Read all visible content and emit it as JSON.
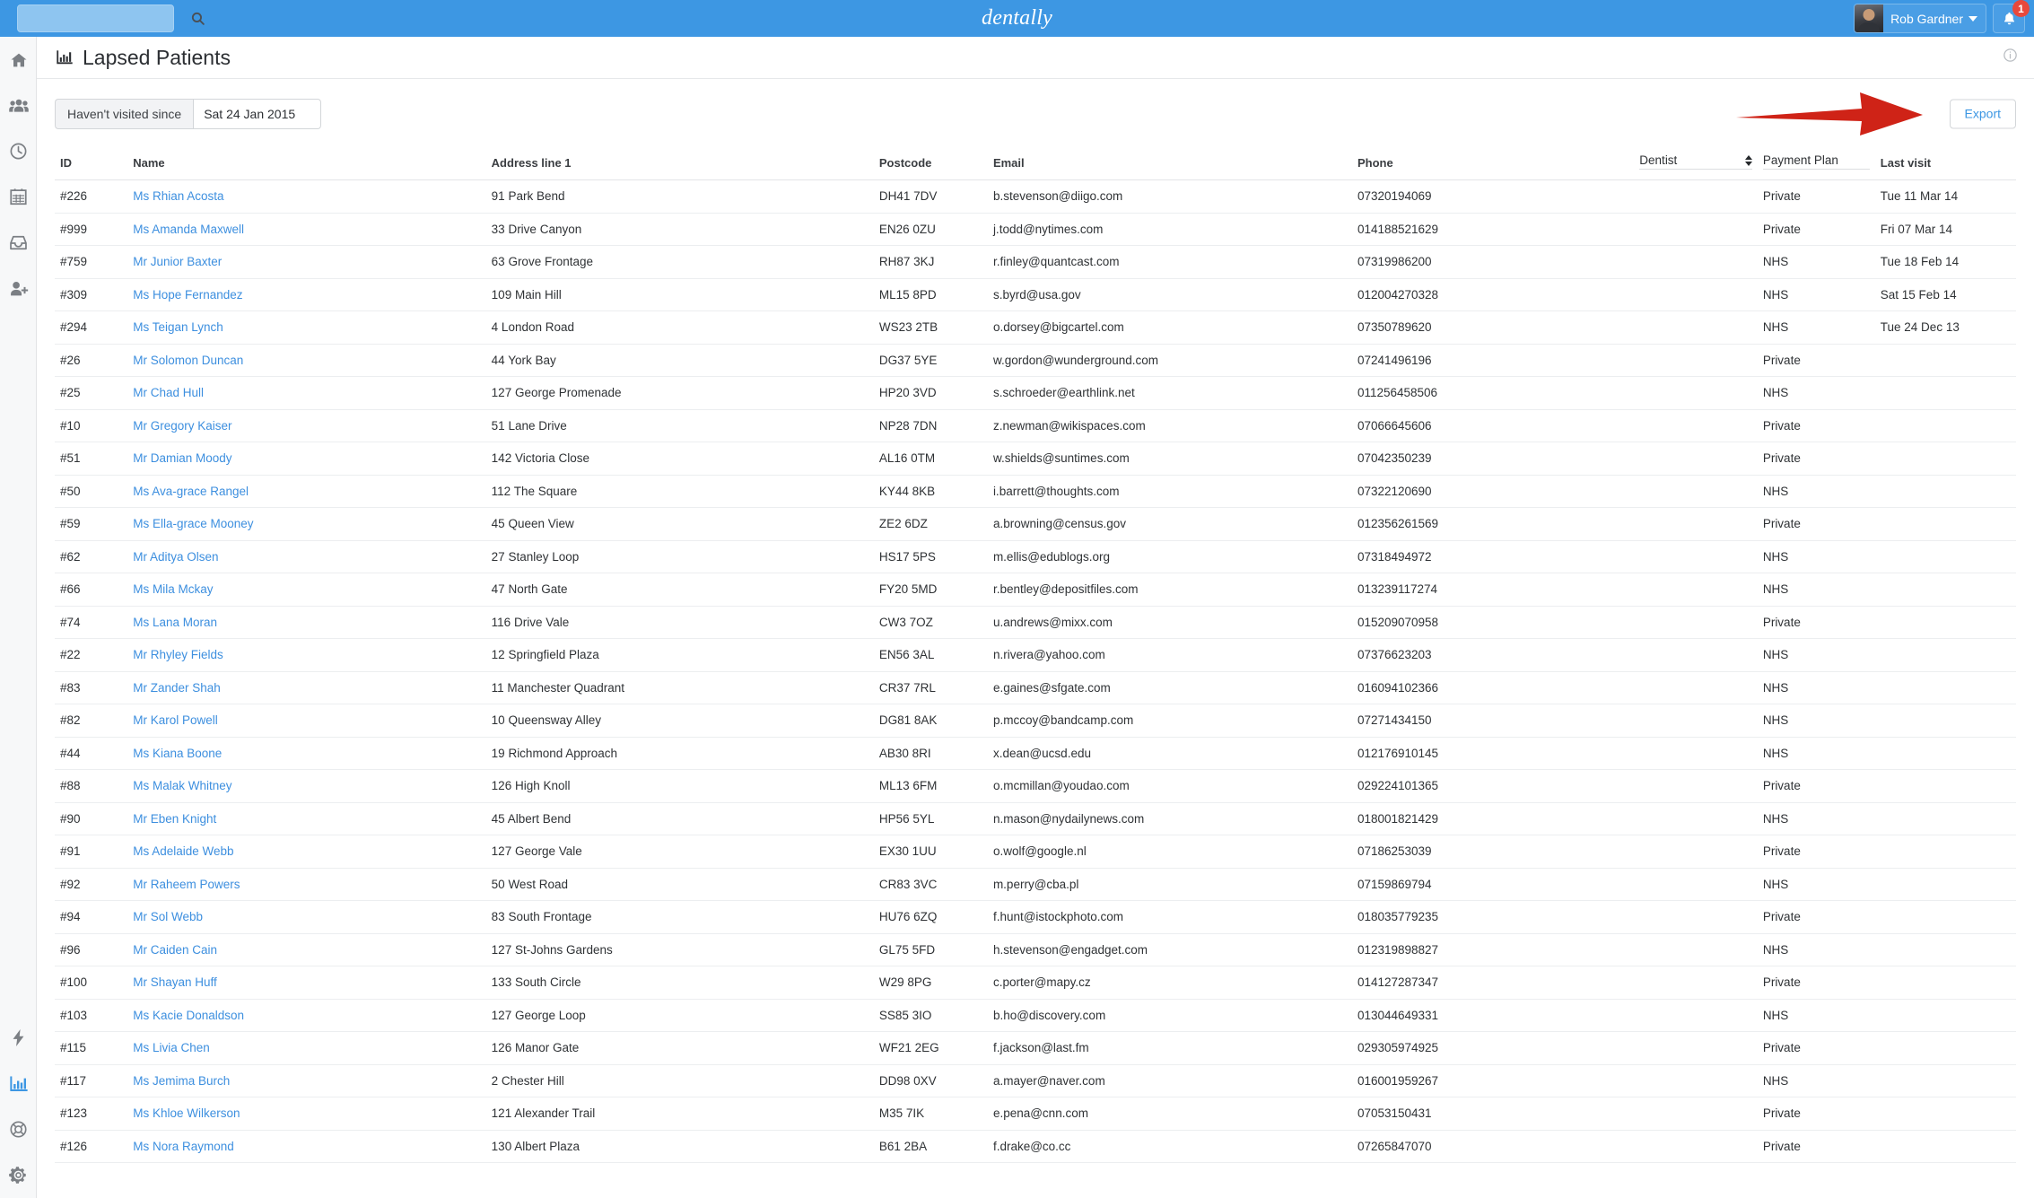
{
  "topbar": {
    "brand": "dentally",
    "search_placeholder": "",
    "search_value": "",
    "search_icon": "search-icon",
    "user_name": "Rob Gardner",
    "notification_count": "1",
    "bell_icon": "bell-icon"
  },
  "sidebar": {
    "items": [
      {
        "icon": "home-icon",
        "label": "Home",
        "active": false
      },
      {
        "icon": "users-icon",
        "label": "Patients",
        "active": false
      },
      {
        "icon": "clock-icon",
        "label": "Recent",
        "active": false
      },
      {
        "icon": "calendar-icon",
        "label": "Diary",
        "active": false
      },
      {
        "icon": "inbox-icon",
        "label": "Inbox",
        "active": false
      },
      {
        "icon": "user-plus-icon",
        "label": "Add Patient",
        "active": false
      }
    ],
    "bottom_items": [
      {
        "icon": "lightning-icon",
        "label": "Activity",
        "active": false
      },
      {
        "icon": "bar-chart-icon",
        "label": "Reporting",
        "active": true
      },
      {
        "icon": "life-ring-icon",
        "label": "Support",
        "active": false
      },
      {
        "icon": "gear-icon",
        "label": "Settings",
        "active": false
      }
    ]
  },
  "page": {
    "title": "Lapsed Patients",
    "title_icon": "bar-chart-icon",
    "info_icon": "info-circle-icon"
  },
  "filter": {
    "label": "Haven't visited since",
    "date_value": "Sat 24 Jan 2015",
    "date_placeholder": "",
    "export_label": "Export",
    "annotation_icon": "red-arrow-icon",
    "annotation_color": "#cf2317"
  },
  "table": {
    "columns": [
      {
        "key": "id",
        "label": "ID",
        "type": "text"
      },
      {
        "key": "name",
        "label": "Name",
        "type": "link"
      },
      {
        "key": "address",
        "label": "Address line 1",
        "type": "text"
      },
      {
        "key": "postcode",
        "label": "Postcode",
        "type": "text"
      },
      {
        "key": "email",
        "label": "Email",
        "type": "text"
      },
      {
        "key": "phone",
        "label": "Phone",
        "type": "text"
      },
      {
        "key": "dentist",
        "label": "Dentist",
        "type": "select"
      },
      {
        "key": "payment_plan",
        "label": "Payment Plan",
        "type": "select"
      },
      {
        "key": "last_visit",
        "label": "Last visit",
        "type": "text"
      }
    ],
    "dentist_filter_value": "Dentist",
    "payment_plan_filter_value": "Payment Plan",
    "rows": [
      {
        "id": "#226",
        "name": "Ms Rhian Acosta",
        "address": "91 Park Bend",
        "postcode": "DH41 7DV",
        "email": "b.stevenson@diigo.com",
        "phone": "07320194069",
        "dentist": "",
        "payment_plan": "Private",
        "last_visit": "Tue 11 Mar 14"
      },
      {
        "id": "#999",
        "name": "Ms Amanda Maxwell",
        "address": "33 Drive Canyon",
        "postcode": "EN26 0ZU",
        "email": "j.todd@nytimes.com",
        "phone": "014188521629",
        "dentist": "",
        "payment_plan": "Private",
        "last_visit": "Fri 07 Mar 14"
      },
      {
        "id": "#759",
        "name": "Mr Junior Baxter",
        "address": "63 Grove Frontage",
        "postcode": "RH87 3KJ",
        "email": "r.finley@quantcast.com",
        "phone": "07319986200",
        "dentist": "",
        "payment_plan": "NHS",
        "last_visit": "Tue 18 Feb 14"
      },
      {
        "id": "#309",
        "name": "Ms Hope Fernandez",
        "address": "109 Main Hill",
        "postcode": "ML15 8PD",
        "email": "s.byrd@usa.gov",
        "phone": "012004270328",
        "dentist": "",
        "payment_plan": "NHS",
        "last_visit": "Sat 15 Feb 14"
      },
      {
        "id": "#294",
        "name": "Ms Teigan Lynch",
        "address": "4 London Road",
        "postcode": "WS23 2TB",
        "email": "o.dorsey@bigcartel.com",
        "phone": "07350789620",
        "dentist": "",
        "payment_plan": "NHS",
        "last_visit": "Tue 24 Dec 13"
      },
      {
        "id": "#26",
        "name": "Mr Solomon Duncan",
        "address": "44 York Bay",
        "postcode": "DG37 5YE",
        "email": "w.gordon@wunderground.com",
        "phone": "07241496196",
        "dentist": "",
        "payment_plan": "Private",
        "last_visit": ""
      },
      {
        "id": "#25",
        "name": "Mr Chad Hull",
        "address": "127 George Promenade",
        "postcode": "HP20 3VD",
        "email": "s.schroeder@earthlink.net",
        "phone": "011256458506",
        "dentist": "",
        "payment_plan": "NHS",
        "last_visit": ""
      },
      {
        "id": "#10",
        "name": "Mr Gregory Kaiser",
        "address": "51 Lane Drive",
        "postcode": "NP28 7DN",
        "email": "z.newman@wikispaces.com",
        "phone": "07066645606",
        "dentist": "",
        "payment_plan": "Private",
        "last_visit": ""
      },
      {
        "id": "#51",
        "name": "Mr Damian Moody",
        "address": "142 Victoria Close",
        "postcode": "AL16 0TM",
        "email": "w.shields@suntimes.com",
        "phone": "07042350239",
        "dentist": "",
        "payment_plan": "Private",
        "last_visit": ""
      },
      {
        "id": "#50",
        "name": "Ms Ava-grace Rangel",
        "address": "112 The Square",
        "postcode": "KY44 8KB",
        "email": "i.barrett@thoughts.com",
        "phone": "07322120690",
        "dentist": "",
        "payment_plan": "NHS",
        "last_visit": ""
      },
      {
        "id": "#59",
        "name": "Ms Ella-grace Mooney",
        "address": "45 Queen View",
        "postcode": "ZE2 6DZ",
        "email": "a.browning@census.gov",
        "phone": "012356261569",
        "dentist": "",
        "payment_plan": "Private",
        "last_visit": ""
      },
      {
        "id": "#62",
        "name": "Mr Aditya Olsen",
        "address": "27 Stanley Loop",
        "postcode": "HS17 5PS",
        "email": "m.ellis@edublogs.org",
        "phone": "07318494972",
        "dentist": "",
        "payment_plan": "NHS",
        "last_visit": ""
      },
      {
        "id": "#66",
        "name": "Ms Mila Mckay",
        "address": "47 North Gate",
        "postcode": "FY20 5MD",
        "email": "r.bentley@depositfiles.com",
        "phone": "013239117274",
        "dentist": "",
        "payment_plan": "NHS",
        "last_visit": ""
      },
      {
        "id": "#74",
        "name": "Ms Lana Moran",
        "address": "116 Drive Vale",
        "postcode": "CW3 7OZ",
        "email": "u.andrews@mixx.com",
        "phone": "015209070958",
        "dentist": "",
        "payment_plan": "Private",
        "last_visit": ""
      },
      {
        "id": "#22",
        "name": "Mr Rhyley Fields",
        "address": "12 Springfield Plaza",
        "postcode": "EN56 3AL",
        "email": "n.rivera@yahoo.com",
        "phone": "07376623203",
        "dentist": "",
        "payment_plan": "NHS",
        "last_visit": ""
      },
      {
        "id": "#83",
        "name": "Mr Zander Shah",
        "address": "11 Manchester Quadrant",
        "postcode": "CR37 7RL",
        "email": "e.gaines@sfgate.com",
        "phone": "016094102366",
        "dentist": "",
        "payment_plan": "NHS",
        "last_visit": ""
      },
      {
        "id": "#82",
        "name": "Mr Karol Powell",
        "address": "10 Queensway Alley",
        "postcode": "DG81 8AK",
        "email": "p.mccoy@bandcamp.com",
        "phone": "07271434150",
        "dentist": "",
        "payment_plan": "NHS",
        "last_visit": ""
      },
      {
        "id": "#44",
        "name": "Ms Kiana Boone",
        "address": "19 Richmond Approach",
        "postcode": "AB30 8RI",
        "email": "x.dean@ucsd.edu",
        "phone": "012176910145",
        "dentist": "",
        "payment_plan": "NHS",
        "last_visit": ""
      },
      {
        "id": "#88",
        "name": "Ms Malak Whitney",
        "address": "126 High Knoll",
        "postcode": "ML13 6FM",
        "email": "o.mcmillan@youdao.com",
        "phone": "029224101365",
        "dentist": "",
        "payment_plan": "Private",
        "last_visit": ""
      },
      {
        "id": "#90",
        "name": "Mr Eben Knight",
        "address": "45 Albert Bend",
        "postcode": "HP56 5YL",
        "email": "n.mason@nydailynews.com",
        "phone": "018001821429",
        "dentist": "",
        "payment_plan": "NHS",
        "last_visit": ""
      },
      {
        "id": "#91",
        "name": "Ms Adelaide Webb",
        "address": "127 George Vale",
        "postcode": "EX30 1UU",
        "email": "o.wolf@google.nl",
        "phone": "07186253039",
        "dentist": "",
        "payment_plan": "Private",
        "last_visit": ""
      },
      {
        "id": "#92",
        "name": "Mr Raheem Powers",
        "address": "50 West Road",
        "postcode": "CR83 3VC",
        "email": "m.perry@cba.pl",
        "phone": "07159869794",
        "dentist": "",
        "payment_plan": "NHS",
        "last_visit": ""
      },
      {
        "id": "#94",
        "name": "Mr Sol Webb",
        "address": "83 South Frontage",
        "postcode": "HU76 6ZQ",
        "email": "f.hunt@istockphoto.com",
        "phone": "018035779235",
        "dentist": "",
        "payment_plan": "Private",
        "last_visit": ""
      },
      {
        "id": "#96",
        "name": "Mr Caiden Cain",
        "address": "127 St-Johns Gardens",
        "postcode": "GL75 5FD",
        "email": "h.stevenson@engadget.com",
        "phone": "012319898827",
        "dentist": "",
        "payment_plan": "NHS",
        "last_visit": ""
      },
      {
        "id": "#100",
        "name": "Mr Shayan Huff",
        "address": "133 South Circle",
        "postcode": "W29 8PG",
        "email": "c.porter@mapy.cz",
        "phone": "014127287347",
        "dentist": "",
        "payment_plan": "Private",
        "last_visit": ""
      },
      {
        "id": "#103",
        "name": "Ms Kacie Donaldson",
        "address": "127 George Loop",
        "postcode": "SS85 3IO",
        "email": "b.ho@discovery.com",
        "phone": "013044649331",
        "dentist": "",
        "payment_plan": "NHS",
        "last_visit": ""
      },
      {
        "id": "#115",
        "name": "Ms Livia Chen",
        "address": "126 Manor Gate",
        "postcode": "WF21 2EG",
        "email": "f.jackson@last.fm",
        "phone": "029305974925",
        "dentist": "",
        "payment_plan": "Private",
        "last_visit": ""
      },
      {
        "id": "#117",
        "name": "Ms Jemima Burch",
        "address": "2 Chester Hill",
        "postcode": "DD98 0XV",
        "email": "a.mayer@naver.com",
        "phone": "016001959267",
        "dentist": "",
        "payment_plan": "NHS",
        "last_visit": ""
      },
      {
        "id": "#123",
        "name": "Ms Khloe Wilkerson",
        "address": "121 Alexander Trail",
        "postcode": "M35 7IK",
        "email": "e.pena@cnn.com",
        "phone": "07053150431",
        "dentist": "",
        "payment_plan": "Private",
        "last_visit": ""
      },
      {
        "id": "#126",
        "name": "Ms Nora Raymond",
        "address": "130 Albert Plaza",
        "postcode": "B61 2BA",
        "email": "f.drake@co.cc",
        "phone": "07265847070",
        "dentist": "",
        "payment_plan": "Private",
        "last_visit": ""
      }
    ]
  },
  "colors": {
    "topbar": "#3d97e3",
    "link": "#3d8fdf",
    "accent": "#3d97e3",
    "badge": "#e8483c",
    "annotation": "#cf2317"
  }
}
